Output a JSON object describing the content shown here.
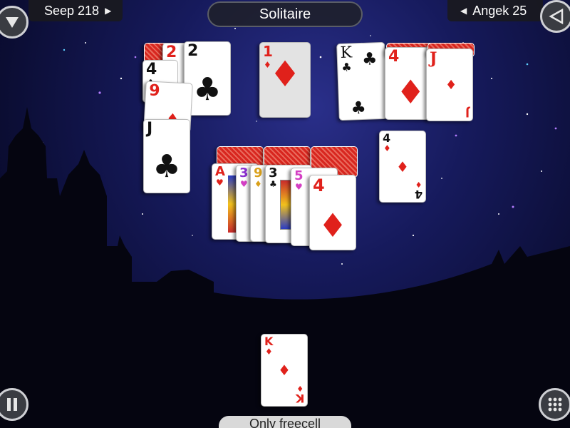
{
  "header": {
    "title": "Solitaire",
    "left_score": "Seep 218",
    "right_score": "Angek 25"
  },
  "icons": {
    "menu": "down-triangle-icon",
    "back": "left-triangle-icon",
    "pause": "pause-icon",
    "grid": "grid-dots-icon"
  },
  "colors": {
    "red_suit": "#e0211b",
    "black_suit": "#111111",
    "card_back": "#d8261f"
  },
  "pile_left": {
    "cards": [
      {
        "rank": "2",
        "suit": "♥"
      },
      {
        "rank": "4",
        "suit": "♣"
      },
      {
        "rank": "2",
        "suit": "♣"
      },
      {
        "rank": "9",
        "suit": "♦"
      },
      {
        "rank": "J",
        "suit": "♣"
      }
    ]
  },
  "pile_center": {
    "rank": "1",
    "suit": "♦"
  },
  "pile_right": {
    "king": {
      "rank": "K",
      "suit": "♣"
    },
    "four": {
      "rank": "4",
      "suit": "♦"
    },
    "jack": {
      "rank": "J",
      "suit": "♦"
    }
  },
  "single_card": {
    "rank": "4",
    "suit": "♦"
  },
  "fan": {
    "cards": [
      {
        "rank": "A",
        "suit": "♥"
      },
      {
        "rank": "3",
        "suit": "♥"
      },
      {
        "rank": "9",
        "suit": "♦"
      },
      {
        "rank": "3",
        "suit": "♣"
      },
      {
        "rank": "5",
        "suit": "♥"
      },
      {
        "rank": "4",
        "suit": "♦"
      }
    ]
  },
  "freecell_card": {
    "rank": "K",
    "suit": "♦"
  },
  "bottom_label": "Only freecell"
}
